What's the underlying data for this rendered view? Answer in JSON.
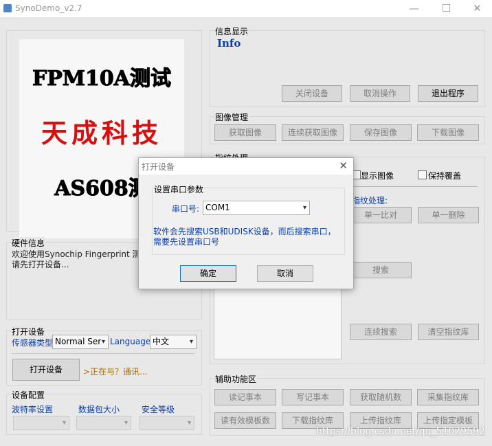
{
  "window": {
    "title": "SynoDemo_v2.7",
    "minimize": "—",
    "maximize": "☐",
    "close": "✕"
  },
  "logo": {
    "line1": "FPM10A测试",
    "line2": "天成科技",
    "line3": "AS608测"
  },
  "hardware": {
    "label": "硬件信息",
    "text_line1": "欢迎使用Synochip Fingerprint 测试程",
    "text_line2": "请先打开设备..."
  },
  "open_device": {
    "label": "打开设备",
    "sensor_type_label": "传感器类型",
    "sensor_type_value": "Normal Ser",
    "language_label": "Language",
    "language_value": "中文",
    "open_button": "打开设备",
    "status": ">正在与？通讯..."
  },
  "device_config": {
    "label": "设备配置",
    "baud_label": "波特率设置",
    "packet_label": "数据包大小",
    "security_label": "安全等级"
  },
  "info": {
    "label": "信息显示",
    "title": "Info",
    "close_device": "关闭设备",
    "cancel_op": "取消操作",
    "exit_program": "退出程序"
  },
  "image_mgmt": {
    "label": "图像管理",
    "get_image": "获取图像",
    "continuous_get": "连续获取图像",
    "save_image": "保存图像",
    "download_image": "下载图像"
  },
  "fingerprint": {
    "label": "指纹处理",
    "show_image": "显示图像",
    "keep_overlay": "保持覆盖",
    "process_label": "指纹处理:",
    "match_one": "单一比对",
    "delete_one": "单一删除",
    "search": "搜索",
    "continuous_search": "连续搜索",
    "clear_library": "清空指纹库"
  },
  "aux": {
    "label": "辅助功能区",
    "read_notepad": "读记事本",
    "write_notepad": "写记事本",
    "get_random": "获取随机数",
    "collect_fp": "采集指纹库",
    "read_valid_templates": "读有效模板数",
    "download_fp_lib": "下载指纹库",
    "upload_fp_lib": "上传指纹库",
    "upload_template": "上传指定模板"
  },
  "dialog": {
    "title": "打开设备",
    "close": "✕",
    "group_label": "设置串口参数",
    "port_label": "串口号:",
    "port_value": "COM1",
    "note_line1": "软件会先搜索USB和UDISK设备，而后搜索串口，",
    "note_line2": "需要先设置串口号",
    "ok": "确定",
    "cancel": "取消"
  },
  "watermark": "https://blog.csdn.net/qq_51029592"
}
